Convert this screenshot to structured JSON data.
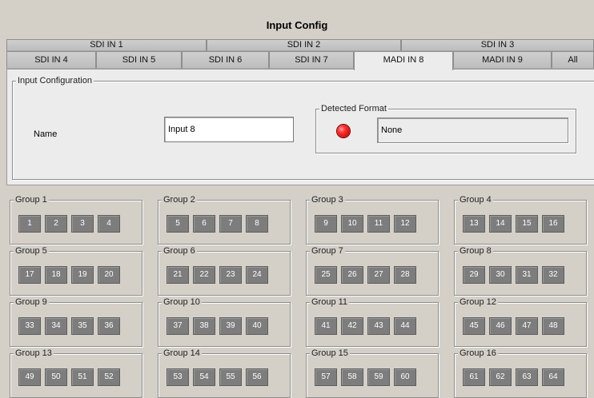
{
  "title": "Input Config",
  "tabs_row1": [
    "SDI IN 1",
    "SDI IN 2",
    "SDI IN 3"
  ],
  "tabs_row2": [
    "SDI IN 4",
    "SDI IN 5",
    "SDI IN 6",
    "SDI IN 7",
    "MADI IN 8",
    "MADI IN 9",
    "All"
  ],
  "active_tab": "MADI IN 8",
  "input_config": {
    "legend": "Input Configuration",
    "name_label": "Name",
    "name_value": "Input 8",
    "detected_legend": "Detected Format",
    "detected_value": "None",
    "status_color": "#ff2a2a"
  },
  "groups": [
    {
      "label": "Group 1",
      "channels": [
        "1",
        "2",
        "3",
        "4"
      ]
    },
    {
      "label": "Group 2",
      "channels": [
        "5",
        "6",
        "7",
        "8"
      ]
    },
    {
      "label": "Group 3",
      "channels": [
        "9",
        "10",
        "11",
        "12"
      ]
    },
    {
      "label": "Group 4",
      "channels": [
        "13",
        "14",
        "15",
        "16"
      ]
    },
    {
      "label": "Group 5",
      "channels": [
        "17",
        "18",
        "19",
        "20"
      ]
    },
    {
      "label": "Group 6",
      "channels": [
        "21",
        "22",
        "23",
        "24"
      ]
    },
    {
      "label": "Group 7",
      "channels": [
        "25",
        "26",
        "27",
        "28"
      ]
    },
    {
      "label": "Group 8",
      "channels": [
        "29",
        "30",
        "31",
        "32"
      ]
    },
    {
      "label": "Group 9",
      "channels": [
        "33",
        "34",
        "35",
        "36"
      ]
    },
    {
      "label": "Group 10",
      "channels": [
        "37",
        "38",
        "39",
        "40"
      ]
    },
    {
      "label": "Group 11",
      "channels": [
        "41",
        "42",
        "43",
        "44"
      ]
    },
    {
      "label": "Group 12",
      "channels": [
        "45",
        "46",
        "47",
        "48"
      ]
    },
    {
      "label": "Group 13",
      "channels": [
        "49",
        "50",
        "51",
        "52"
      ]
    },
    {
      "label": "Group 14",
      "channels": [
        "53",
        "54",
        "55",
        "56"
      ]
    },
    {
      "label": "Group 15",
      "channels": [
        "57",
        "58",
        "59",
        "60"
      ]
    },
    {
      "label": "Group 16",
      "channels": [
        "61",
        "62",
        "63",
        "64"
      ]
    }
  ]
}
